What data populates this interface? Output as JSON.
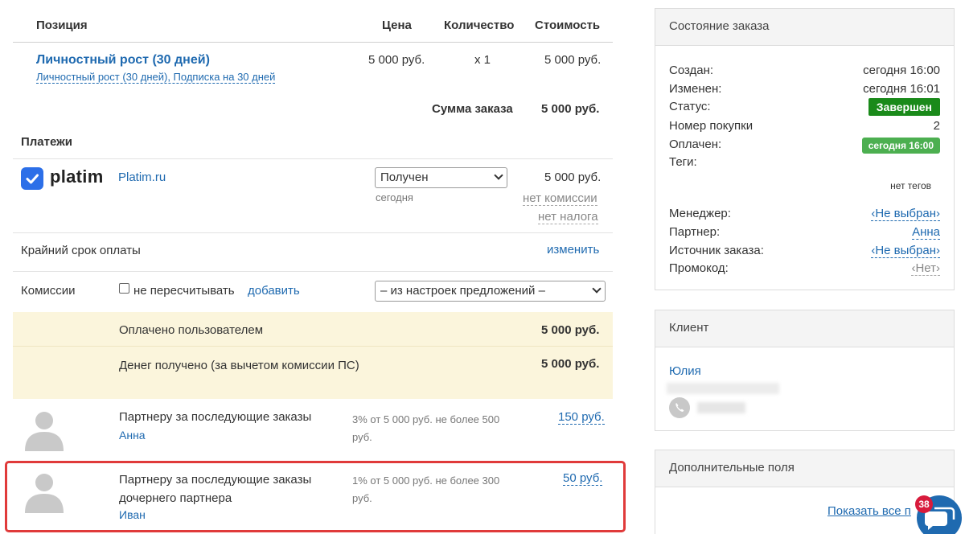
{
  "header": {
    "position": "Позиция",
    "price": "Цена",
    "quantity": "Количество",
    "cost": "Стоимость"
  },
  "item": {
    "title": "Личностный рост (30 дней)",
    "subtitle": "Личностный рост (30 дней), Подписка на 30 дней",
    "price": "5 000 руб.",
    "quantity": "x 1",
    "cost": "5 000 руб."
  },
  "order_sum": {
    "label": "Сумма заказа",
    "value": "5 000 руб."
  },
  "payments": {
    "title": "Платежи",
    "logo_text": "platim",
    "provider": "Platim.ru",
    "status_value": "Получен",
    "date": "сегодня",
    "amount": "5 000 руб.",
    "no_commission": "нет комиссии",
    "no_tax": "нет налога"
  },
  "deadline": {
    "label": "Крайний срок оплаты",
    "action": "изменить"
  },
  "commissions": {
    "label": "Комиссии",
    "checkbox_label": "не пересчитывать",
    "add": "добавить",
    "select_value": "– из настроек предложений –"
  },
  "paid_by_user": {
    "label": "Оплачено пользователем",
    "value": "5 000 руб."
  },
  "money_received": {
    "label": "Денег получено (за вычетом комиссии ПС)",
    "value": "5 000 руб."
  },
  "partners": [
    {
      "title": "Партнеру за последующие заказы",
      "name": "Анна",
      "desc": "3% от 5 000 руб. не более 500 руб.",
      "amount": "150 руб."
    },
    {
      "title": "Партнеру за последующие заказы дочернего партнера",
      "name": "Иван",
      "desc": "1% от 5 000 руб. не более 300 руб.",
      "amount": "50 руб."
    }
  ],
  "order_state": {
    "title": "Состояние заказа",
    "created_label": "Создан:",
    "created_value": "сегодня 16:00",
    "changed_label": "Изменен:",
    "changed_value": "сегодня 16:01",
    "status_label": "Статус:",
    "status_value": "Завершен",
    "purchase_label": "Номер покупки",
    "purchase_value": "2",
    "paid_label": "Оплачен:",
    "paid_value": "сегодня 16:00",
    "tags_label": "Теги:",
    "tags_value": "нет тегов",
    "manager_label": "Менеджер:",
    "manager_value": "‹Не выбран›",
    "partner_label": "Партнер:",
    "partner_value": "Анна",
    "source_label": "Источник заказа:",
    "source_value": "‹Не выбран›",
    "promo_label": "Промокод:",
    "promo_value": "‹Нет›"
  },
  "client": {
    "title": "Клиент",
    "name": "Юлия"
  },
  "extra_fields": {
    "title": "Дополнительные поля",
    "show_all": "Показать все п"
  },
  "chat": {
    "unread_count": "38"
  },
  "colors": {
    "link": "#1f6ab0",
    "status_green": "#1a8a1a",
    "paid_green": "#4caf50",
    "highlight": "#fbf5dc",
    "alert_border": "#e03a3a",
    "chat_badge": "#d81b3c"
  }
}
